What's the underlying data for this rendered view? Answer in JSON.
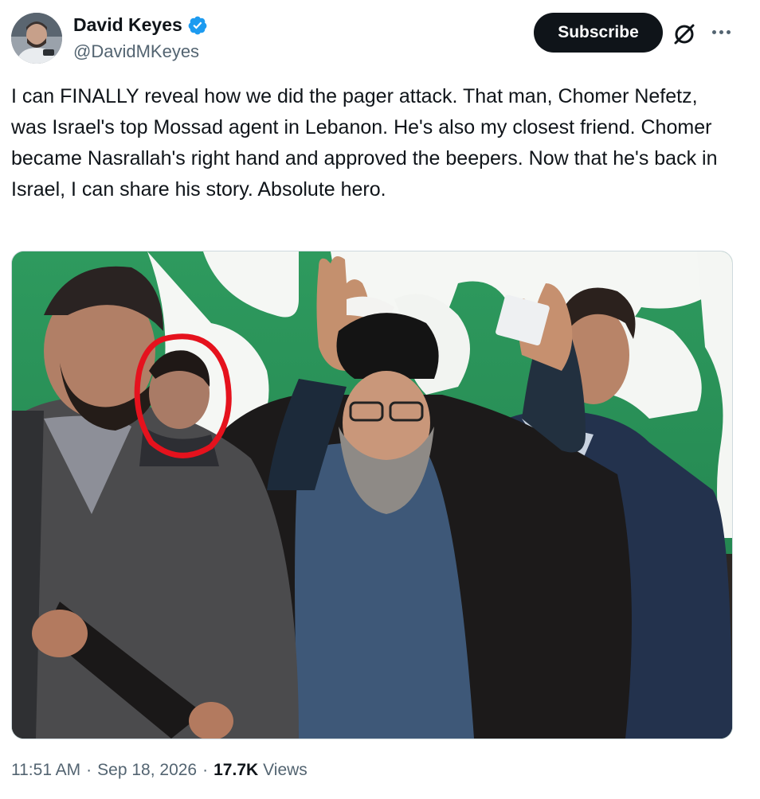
{
  "author": {
    "display_name": "David Keyes",
    "handle": "@DavidMKeyes",
    "verified": true
  },
  "header": {
    "subscribe_label": "Subscribe",
    "icons": [
      "verified-badge-icon",
      "grok-icon",
      "more-options-icon"
    ]
  },
  "tweet": {
    "text": "I can FINALLY reveal how we did the pager attack. That man, Chomer Nefetz, was Israel's top Mossad agent in Lebanon. He's also my closest friend. Chomer became Nasrallah's right hand and approved the beepers. Now that he's back in Israel, I can share his story. Absolute hero."
  },
  "meta": {
    "time": "11:51 AM",
    "date": "Sep 18, 2026",
    "views_count": "17.7K",
    "views_label": "Views",
    "separator": "·"
  },
  "colors": {
    "verified_blue": "#1d9bf0",
    "text_primary": "#0f1419",
    "text_secondary": "#536471",
    "highlight_circle": "#e5121d",
    "banner_green": "#1a9a5a"
  }
}
